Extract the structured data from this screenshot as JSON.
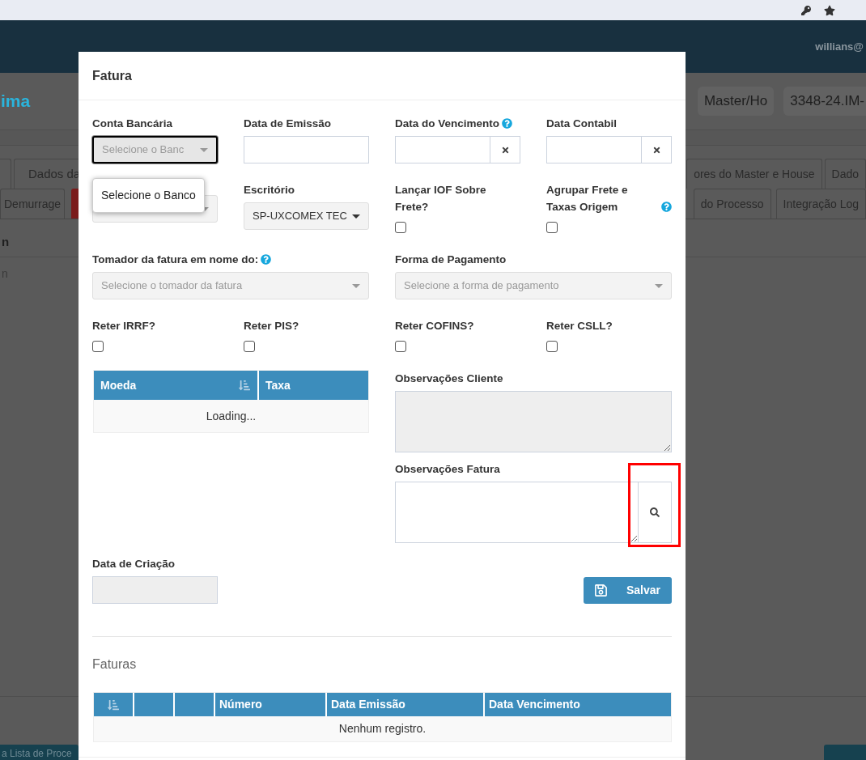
{
  "page": {
    "user": "willians@",
    "brand": "ima",
    "header_fields": [
      "Master/Ho",
      "3348-24.IM-"
    ],
    "tabs_top_left": [
      "Dados da"
    ],
    "tabs_top_right": [
      "ores do Master e House",
      "Dado"
    ],
    "tabs_bottom_left": [
      "Demurrage"
    ],
    "alert_tab": true,
    "tabs_bottom_right": [
      "do Processo",
      "Integração Log"
    ],
    "section_heading": "n",
    "section_text": "n",
    "back_button": "a Lista de Proce"
  },
  "modal": {
    "title": "Fatura",
    "rows": [
      [
        {
          "kind": "select",
          "label": "Conta Bancária",
          "placeholder": "Selecione o Banc",
          "focused": true,
          "open": true,
          "options": [
            "Selecione o Banco"
          ]
        },
        {
          "kind": "text",
          "label": "Data de Emissão"
        },
        {
          "kind": "date",
          "label": "Data do Vencimento",
          "help": true
        },
        {
          "kind": "date",
          "label": "Data Contabil"
        }
      ],
      [
        {
          "kind": "select"
        },
        {
          "kind": "select",
          "label": "Escritório",
          "value": "SP-UXCOMEX TEC"
        },
        {
          "kind": "checkbox",
          "label": "Lançar IOF Sobre Frete?",
          "checked": false
        },
        {
          "kind": "checkbox",
          "label": "Agrupar Frete e Taxas Origem",
          "help": true,
          "checked": false
        }
      ],
      [
        {
          "kind": "checkbox",
          "label": "Reter IRRF?",
          "checked": false
        },
        {
          "kind": "checkbox",
          "label": "Reter PIS?",
          "checked": false
        },
        {
          "kind": "checkbox",
          "label": "Reter COFINS?",
          "checked": false
        },
        {
          "kind": "checkbox",
          "label": "Reter CSLL?",
          "checked": false
        }
      ]
    ],
    "payer": {
      "kind": "select",
      "label": "Tomador da fatura em nome do:",
      "help": true,
      "placeholder": "Selecione o tomador da fatura"
    },
    "payment": {
      "kind": "select",
      "label": "Forma de Pagamento",
      "placeholder": "Selecione a forma de pagamento"
    },
    "currency_table": {
      "columns": [
        "Moeda",
        "Taxa"
      ],
      "message": "Loading..."
    },
    "created": {
      "label": "Data de Criação"
    },
    "client_notes": {
      "label": "Observações Cliente",
      "disabled": true
    },
    "invoice_notes": {
      "label": "Observações Fatura",
      "search_highlighted": true
    },
    "save_button": "Salvar",
    "invoices": {
      "title": "Faturas",
      "columns": [
        {
          "kind": "sort"
        },
        {
          "kind": "blank"
        },
        {
          "kind": "blank"
        },
        {
          "kind": "text",
          "label": "Número"
        },
        {
          "kind": "text",
          "label": "Data Emissão"
        },
        {
          "kind": "text",
          "label": "Data Vencimento"
        }
      ],
      "message": "Nenhum registro."
    }
  }
}
